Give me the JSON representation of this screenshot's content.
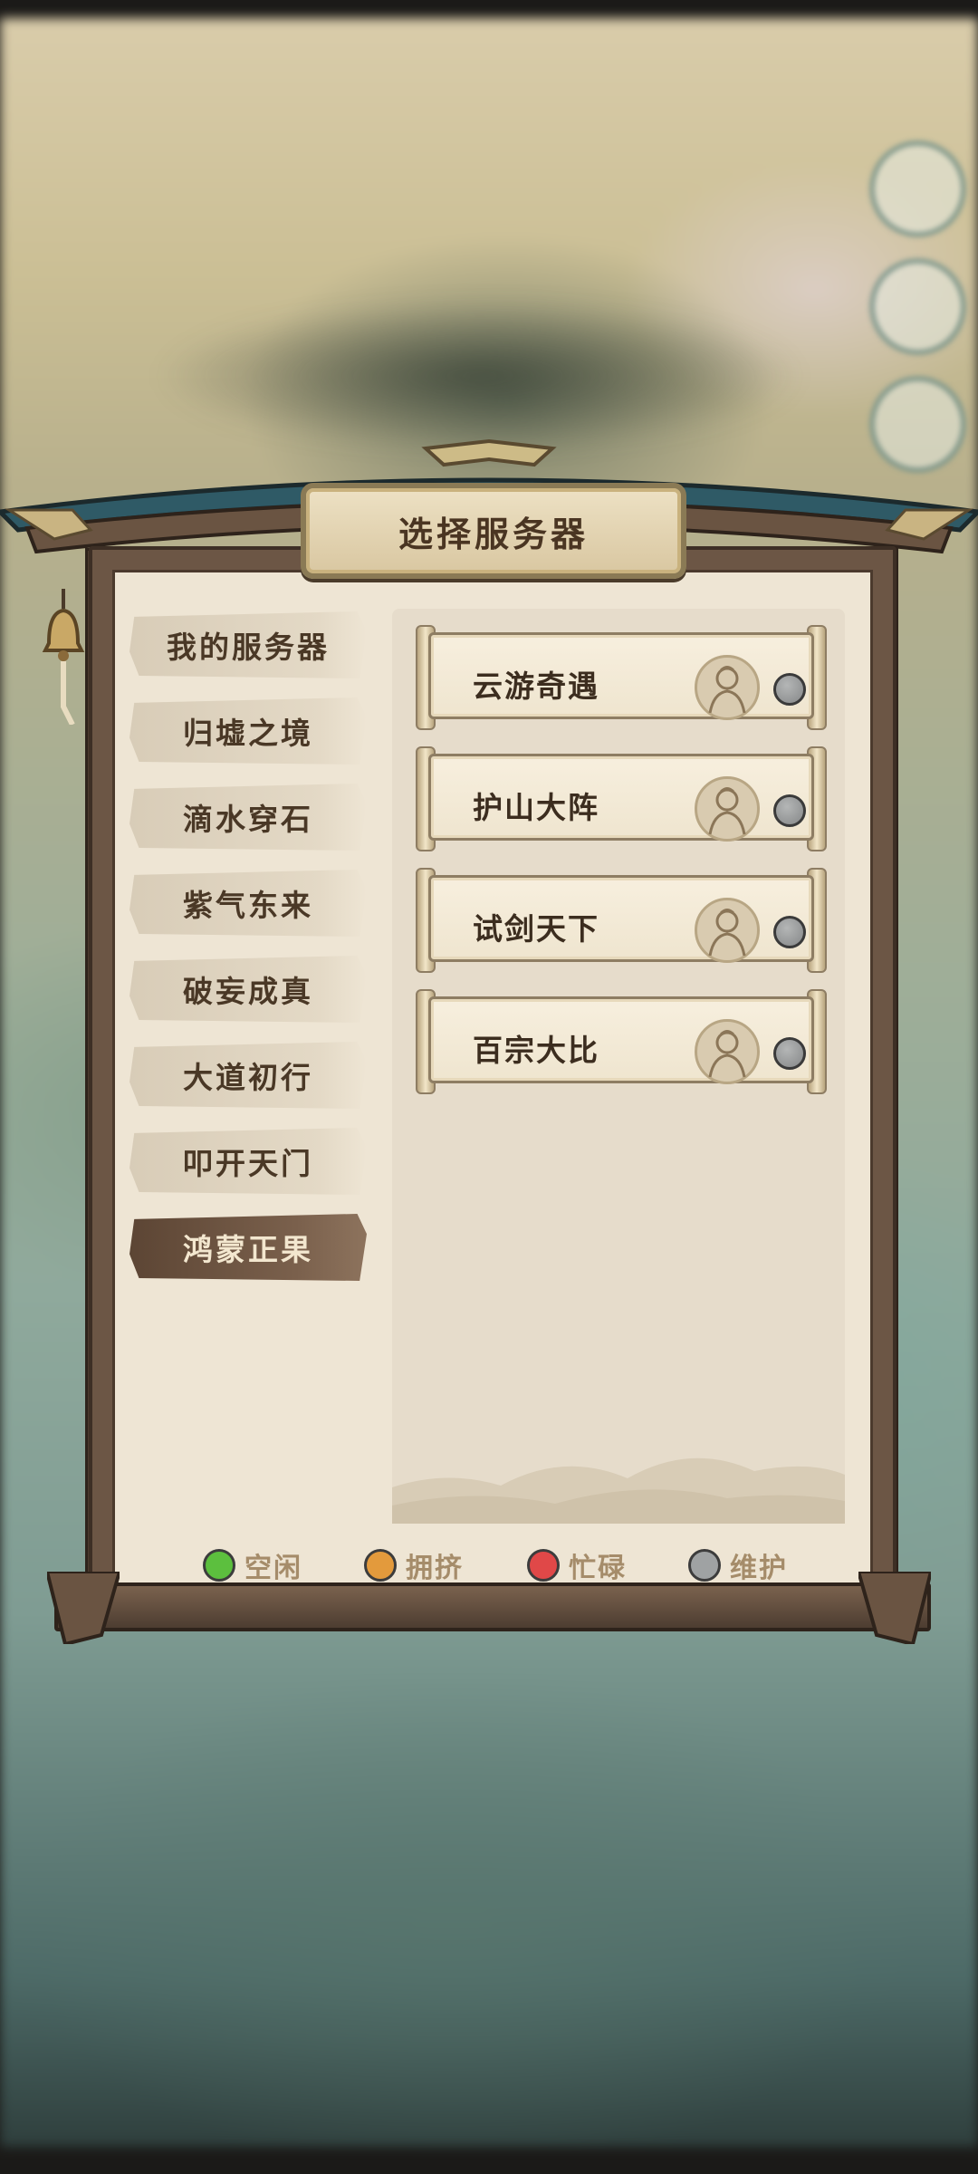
{
  "dialog": {
    "title": "选择服务器"
  },
  "sidebar": {
    "items": [
      {
        "label": "我的服务器",
        "active": false
      },
      {
        "label": "归墟之境",
        "active": false
      },
      {
        "label": "滴水穿石",
        "active": false
      },
      {
        "label": "紫气东来",
        "active": false
      },
      {
        "label": "破妄成真",
        "active": false
      },
      {
        "label": "大道初行",
        "active": false
      },
      {
        "label": "叩开天门",
        "active": false
      },
      {
        "label": "鸿蒙正果",
        "active": true
      }
    ]
  },
  "servers": [
    {
      "name": "云游奇遇",
      "status": "maintenance"
    },
    {
      "name": "护山大阵",
      "status": "maintenance"
    },
    {
      "name": "试剑天下",
      "status": "maintenance"
    },
    {
      "name": "百宗大比",
      "status": "maintenance"
    }
  ],
  "legend": [
    {
      "label": "空闲",
      "color": "#5cbf3e"
    },
    {
      "label": "拥挤",
      "color": "#e39a3c"
    },
    {
      "label": "忙碌",
      "color": "#e04848"
    },
    {
      "label": "维护",
      "color": "#9fa2a3"
    }
  ],
  "colors": {
    "maintenance": "#9fa2a3",
    "active_tab": "#6b5240",
    "frame": "#6c5645"
  }
}
